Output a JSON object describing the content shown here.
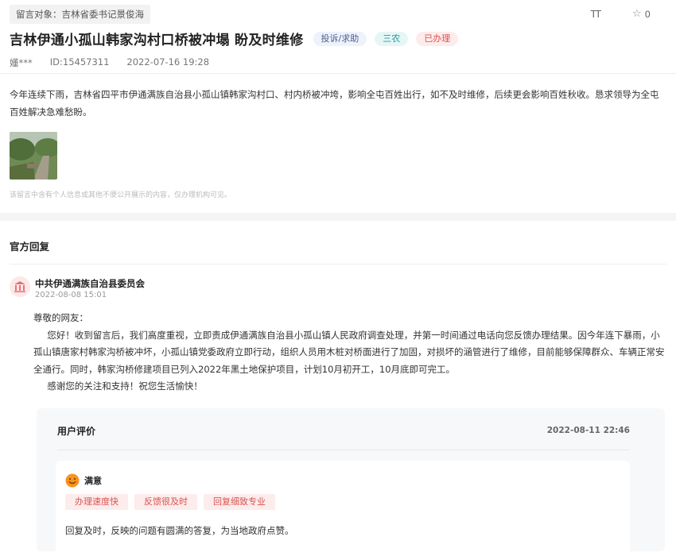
{
  "header": {
    "target": "留言对象：吉林省委书记景俊海",
    "font_icon_text": "TT",
    "fav_count": "0"
  },
  "post": {
    "title": "吉林伊通小孤山韩家沟村口桥被冲塌 盼及时维修",
    "tags": [
      "投诉/求助",
      "三农",
      "已办理"
    ],
    "author": "嬞***",
    "id": "ID:15457311",
    "time": "2022-07-16 19:28",
    "content": "今年连续下雨，吉林省四平市伊通满族自治县小孤山镇韩家沟村口、村内桥被冲垮，影响全屯百姓出行，如不及时维修，后续更会影响百姓秋收。恳求领导为全屯百姓解决急难愁盼。",
    "privacy_note": "该留言中含有个人信息或其他不便公开展示的内容，仅办理机构可见。"
  },
  "official_reply": {
    "section_title": "官方回复",
    "org_name": "中共伊通满族自治县委员会",
    "time": "2022-08-08 15:01",
    "greeting": "尊敬的网友：",
    "body": "您好！收到留言后，我们高度重视，立即责成伊通满族自治县小孤山镇人民政府调查处理，并第一时间通过电话向您反馈办理结果。因今年连下暴雨，小孤山镇唐家村韩家沟桥被冲坏，小孤山镇党委政府立即行动，组织人员用木桩对桥面进行了加固，对损坏的涵管进行了维修，目前能够保障群众、车辆正常安全通行。同时，韩家沟桥修建项目已列入2022年黑土地保护项目，计划10月初开工，10月底即可完工。",
    "closing": "感谢您的关注和支持！祝您生活愉快！"
  },
  "evaluation": {
    "title": "用户评价",
    "time": "2022-08-11 22:46",
    "rating": "满意",
    "chips": [
      "办理速度快",
      "反馈很及时",
      "回复细致专业"
    ],
    "comment": "回复及时，反映的问题有圆满的答复，为当地政府点赞。"
  },
  "colors": {
    "accent_red": "#d9534f",
    "tag_blue": "#4a5f8c",
    "tag_green": "#2a9d9d"
  }
}
